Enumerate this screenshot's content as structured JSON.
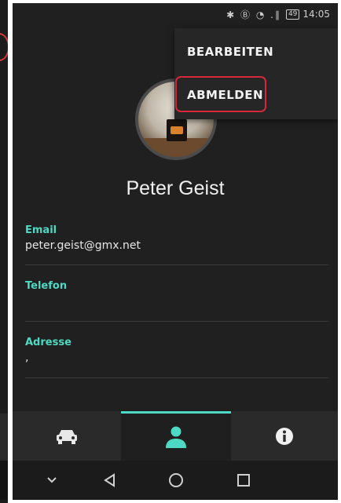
{
  "status_bar": {
    "icons": "✱ Ⓑ ◔ .∥",
    "battery": "49",
    "time": "14:05"
  },
  "menu": {
    "edit_label": "BEARBEITEN",
    "logout_label": "ABMELDEN"
  },
  "profile": {
    "name": "Peter Geist"
  },
  "fields": {
    "email_label": "Email",
    "email_value": "peter.geist@gmx.net",
    "phone_label": "Telefon",
    "phone_value": "",
    "address_label": "Adresse",
    "address_value": ","
  },
  "tabs": [
    {
      "icon": "car-icon",
      "active": false
    },
    {
      "icon": "person-icon",
      "active": true
    },
    {
      "icon": "info-icon",
      "active": false
    }
  ],
  "colors": {
    "accent": "#4dd9c3",
    "highlight": "#d6283a",
    "background": "#202020",
    "menu_background": "#262626"
  }
}
